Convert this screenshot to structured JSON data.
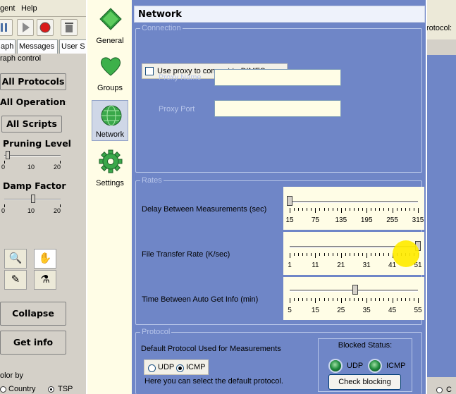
{
  "background_app": {
    "menu": [
      "gent",
      "Help"
    ],
    "tabs": [
      "aph",
      "Messages",
      "User S"
    ],
    "panel_title": "raph control",
    "buttons": [
      "All Protocols",
      "All Operations",
      "All Scripts"
    ],
    "pruning_label": "Pruning Level",
    "damp_label": "Damp Factor",
    "slider_ticks": [
      "0",
      "10",
      "20"
    ],
    "collapse_label": "Collapse",
    "getinfo_label": "Get info",
    "color_by_label": "olor by",
    "country_label": "Country",
    "tsp_label": "TSP",
    "right_protocol_label": "rotocol:",
    "right_bottom_label": "C"
  },
  "dialog": {
    "nav": [
      {
        "label": "General",
        "icon": "diamond-icon"
      },
      {
        "label": "Groups",
        "icon": "heart-icon"
      },
      {
        "label": "Network",
        "icon": "globe-icon"
      },
      {
        "label": "Settings",
        "icon": "gear-icon"
      }
    ],
    "active_nav": "Network",
    "page_title": "Network",
    "connection": {
      "title": "Connection",
      "use_proxy_label": "Use proxy to connect to DIMES server",
      "use_proxy_checked": false,
      "proxy_name_label": "Proxy Name",
      "proxy_name_value": "",
      "proxy_port_label": "Proxy Port",
      "proxy_port_value": ""
    },
    "rates": {
      "title": "Rates",
      "delay": {
        "label": "Delay Between Measurements (sec)",
        "ticks": [
          "15",
          "75",
          "135",
          "195",
          "255",
          "315"
        ],
        "value": 15,
        "min": 15,
        "max": 315
      },
      "transfer": {
        "label": "File Transfer Rate (K/sec)",
        "ticks": [
          "1",
          "11",
          "21",
          "31",
          "41",
          "51"
        ],
        "value": 51,
        "min": 1,
        "max": 51
      },
      "autoget": {
        "label": "Time Between Auto Get Info (min)",
        "ticks": [
          "5",
          "15",
          "25",
          "35",
          "45",
          "55"
        ],
        "value": 33,
        "min": 5,
        "max": 60
      }
    },
    "protocol": {
      "title": "Protocol",
      "default_label": "Default Protocol Used for Measurements",
      "options": [
        "UDP",
        "ICMP"
      ],
      "selected": "ICMP",
      "hint": "Here you can select the default protocol.",
      "blocked_title": "Blocked Status:",
      "blocked_items": [
        "UDP",
        "ICMP"
      ],
      "check_blocking_label": "Check blocking"
    }
  },
  "colors": {
    "content_bg": "#6f86c7",
    "nav_bg": "#fffde6",
    "cursor_highlight": "#ffec00"
  }
}
